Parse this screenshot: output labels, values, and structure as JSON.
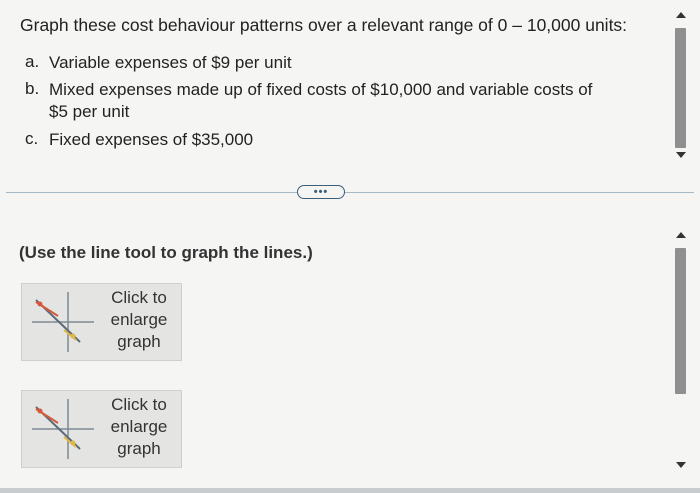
{
  "question": {
    "text": "Graph these cost behaviour patterns over a relevant range of 0 – 10,000 units:",
    "options": [
      {
        "letter": "a.",
        "text": "Variable expenses of $9 per unit"
      },
      {
        "letter": "b.",
        "line1": "Mixed expenses made up of fixed costs of $10,000 and variable costs of",
        "line2": "$5 per unit"
      },
      {
        "letter": "c.",
        "text": "Fixed expenses of $35,000"
      }
    ]
  },
  "more_button": {
    "label": "•••"
  },
  "answer": {
    "instruction": "(Use the line tool to graph the lines.)",
    "graph_buttons": [
      {
        "line1": "Click to",
        "line2": "enlarge",
        "line3": "graph"
      },
      {
        "line1": "Click to",
        "line2": "enlarge",
        "line3": "graph"
      }
    ]
  },
  "colors": {
    "divider": "#a6b8c4",
    "accent": "#3a5f7a",
    "scroll_thumb": "#8f8f8f"
  },
  "icons": [
    "scroll-up-icon",
    "scroll-down-icon",
    "graph-thumbnail-icon"
  ]
}
